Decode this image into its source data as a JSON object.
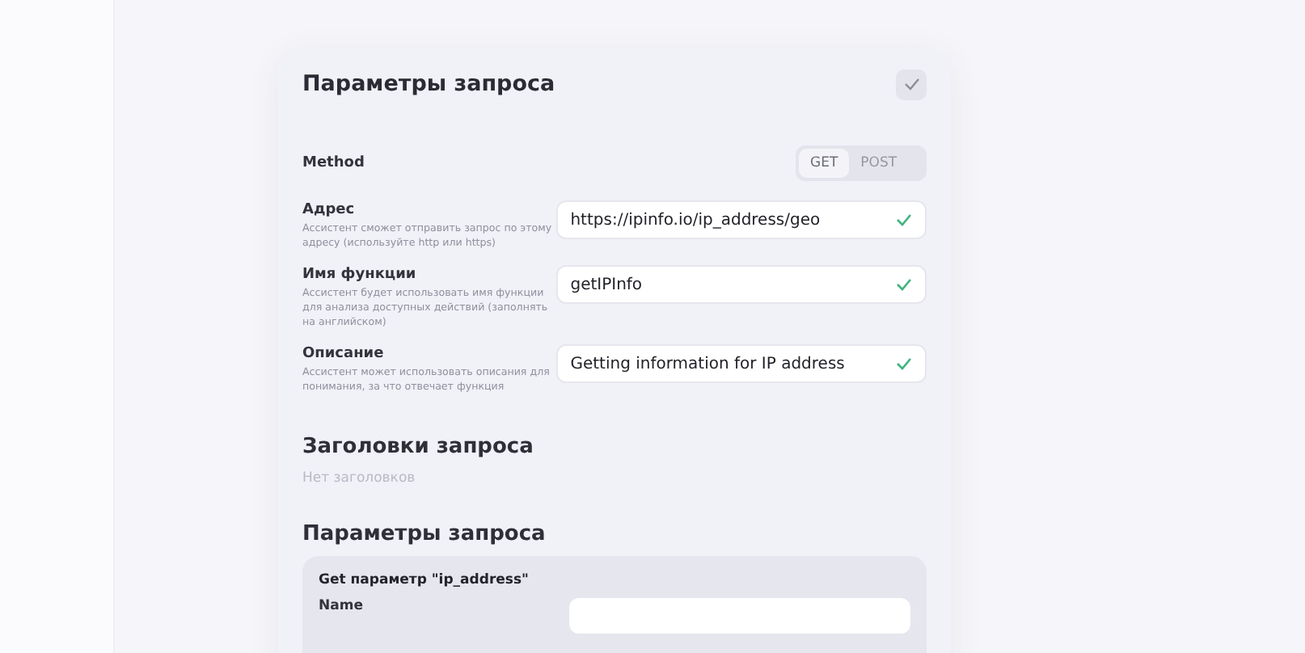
{
  "dialog": {
    "title": "Параметры запроса",
    "method": {
      "label": "Method",
      "options": [
        {
          "label": "GET",
          "selected": true
        },
        {
          "label": "POST",
          "selected": false
        }
      ]
    },
    "fields": [
      {
        "label": "Адрес",
        "hint": "Ассистент сможет отправить запрос по этому адресу (используйте http или https)",
        "value": "https://ipinfo.io/ip_address/geo",
        "valid": true
      },
      {
        "label": "Имя функции",
        "hint": "Ассистент будет использовать имя функции для анализа доступных действий (заполнять на английском)",
        "value": "getIPInfo",
        "valid": true
      },
      {
        "label": "Описание",
        "hint": "Ассистент может использовать описания для понимания, за что отвечает функция",
        "value": "Getting information for IP address",
        "valid": true
      }
    ],
    "headers": {
      "title": "Заголовки запроса",
      "empty_text": "Нет заголовков"
    },
    "params": {
      "title": "Параметры запроса",
      "cards": [
        {
          "title": "Get параметр \"ip_address\"",
          "field_label": "Name"
        }
      ]
    }
  }
}
